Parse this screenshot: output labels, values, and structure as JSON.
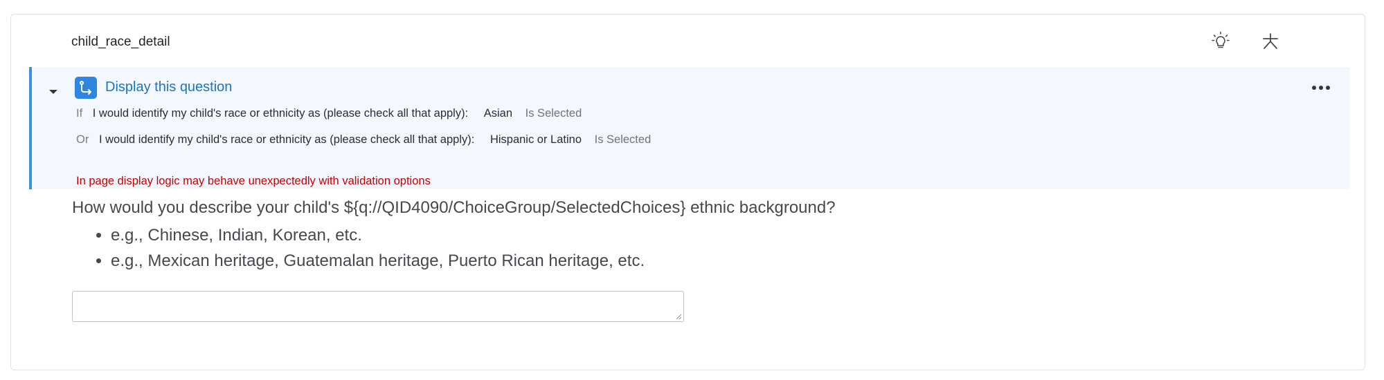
{
  "question": {
    "id_label": "child_race_detail",
    "text": "How would you describe your child's ${q://QID4090/ChoiceGroup/SelectedChoices} ethnic background?",
    "bullets": [
      "e.g., Chinese, Indian, Korean, etc.",
      "e.g., Mexican heritage, Guatemalan heritage, Puerto Rican heritage, etc."
    ],
    "answer_value": ""
  },
  "icons": {
    "top": [
      "lightbulb-icon",
      "asterisk-icon"
    ],
    "logic": "display-logic-icon",
    "caret": "caret-down-icon",
    "more": "more-horizontal-icon"
  },
  "display_logic": {
    "title": "Display this question",
    "conditions": [
      {
        "conjunction": "If",
        "question": "I would identify my child's race or ethnicity as (please check all that apply):",
        "choice": "Asian",
        "operator": "Is Selected"
      },
      {
        "conjunction": "Or",
        "question": "I would identify my child's race or ethnicity as (please check all that apply):",
        "choice": "Hispanic or Latino",
        "operator": "Is Selected"
      }
    ],
    "warning": "In page display logic may behave unexpectedly with validation options"
  },
  "colors": {
    "accent": "#2e86de",
    "link": "#1a73c8",
    "logic_bg": "#f2f8fe",
    "warning": "#c40000"
  }
}
